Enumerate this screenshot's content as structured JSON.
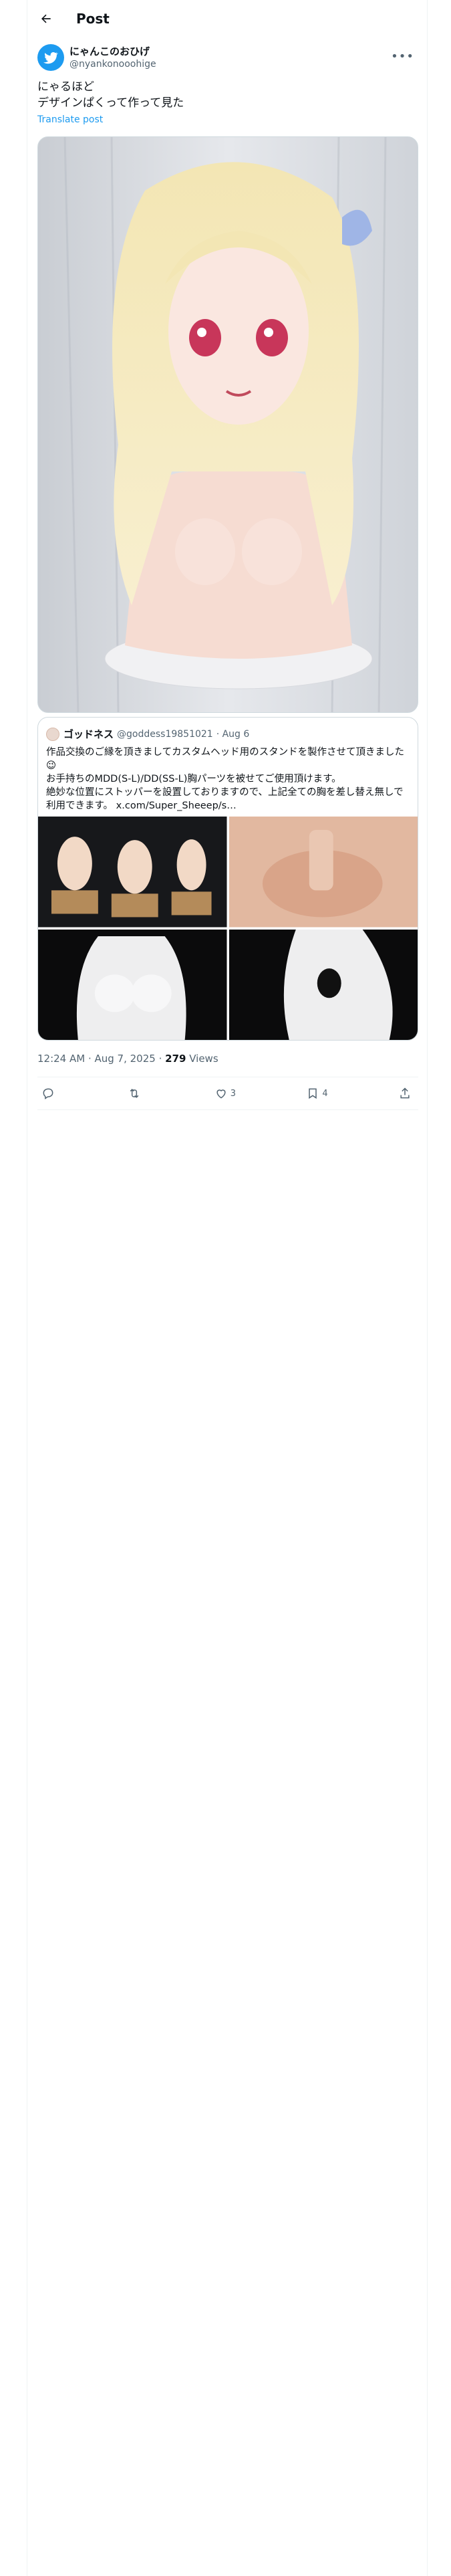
{
  "header": {
    "title": "Post"
  },
  "post": {
    "author": {
      "display_name": "にゃんこのおひげ",
      "handle": "@nyankonooohige"
    },
    "text": "にゃるほど\nデザインぱくって作って見た",
    "translate_label": "Translate post",
    "quote": {
      "author": {
        "display_name": "ゴッドネス",
        "handle": "@goddess19851021",
        "date": "· Aug 6"
      },
      "text": "作品交換のご縁を頂きましてカスタムヘッド用のスタンドを製作させて頂きました😉\nお手持ちのMDD(S-L)/DD(SS-L)胸パーツを被せてご使用頂けます。\n絶妙な位置にストッパーを設置しておりますので、上記全ての胸を差し替え無しで利用できます。 x.com/Super_Sheeep/s…"
    },
    "timestamp": "12:24 AM · Aug 7, 2025 ·",
    "views_count": "279",
    "views_label": "Views",
    "actions": {
      "reply": "",
      "repost": "",
      "like": "3",
      "bookmark": "4",
      "share": ""
    }
  },
  "colors": {
    "accent": "#1d9bf0",
    "text": "#0f1419",
    "muted": "#536471",
    "border": "#cfd9de"
  }
}
